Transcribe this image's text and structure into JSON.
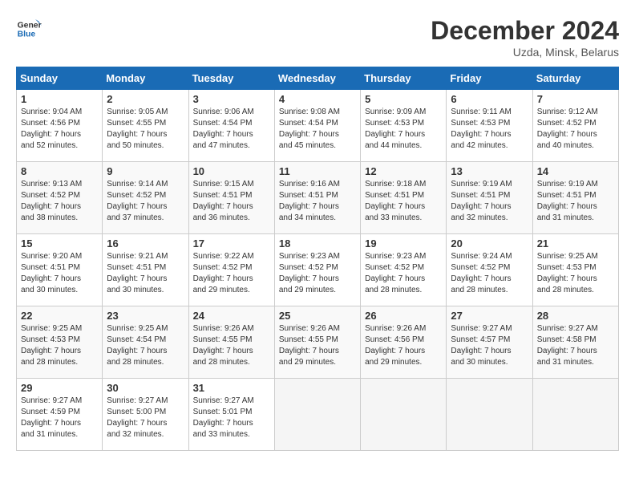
{
  "header": {
    "logo_line1": "General",
    "logo_line2": "Blue",
    "month": "December 2024",
    "location": "Uzda, Minsk, Belarus"
  },
  "days_of_week": [
    "Sunday",
    "Monday",
    "Tuesday",
    "Wednesday",
    "Thursday",
    "Friday",
    "Saturday"
  ],
  "weeks": [
    [
      {
        "num": "1",
        "sunrise": "9:04 AM",
        "sunset": "4:56 PM",
        "daylight": "7 hours and 52 minutes."
      },
      {
        "num": "2",
        "sunrise": "9:05 AM",
        "sunset": "4:55 PM",
        "daylight": "7 hours and 50 minutes."
      },
      {
        "num": "3",
        "sunrise": "9:06 AM",
        "sunset": "4:54 PM",
        "daylight": "7 hours and 47 minutes."
      },
      {
        "num": "4",
        "sunrise": "9:08 AM",
        "sunset": "4:54 PM",
        "daylight": "7 hours and 45 minutes."
      },
      {
        "num": "5",
        "sunrise": "9:09 AM",
        "sunset": "4:53 PM",
        "daylight": "7 hours and 44 minutes."
      },
      {
        "num": "6",
        "sunrise": "9:11 AM",
        "sunset": "4:53 PM",
        "daylight": "7 hours and 42 minutes."
      },
      {
        "num": "7",
        "sunrise": "9:12 AM",
        "sunset": "4:52 PM",
        "daylight": "7 hours and 40 minutes."
      }
    ],
    [
      {
        "num": "8",
        "sunrise": "9:13 AM",
        "sunset": "4:52 PM",
        "daylight": "7 hours and 38 minutes."
      },
      {
        "num": "9",
        "sunrise": "9:14 AM",
        "sunset": "4:52 PM",
        "daylight": "7 hours and 37 minutes."
      },
      {
        "num": "10",
        "sunrise": "9:15 AM",
        "sunset": "4:51 PM",
        "daylight": "7 hours and 36 minutes."
      },
      {
        "num": "11",
        "sunrise": "9:16 AM",
        "sunset": "4:51 PM",
        "daylight": "7 hours and 34 minutes."
      },
      {
        "num": "12",
        "sunrise": "9:18 AM",
        "sunset": "4:51 PM",
        "daylight": "7 hours and 33 minutes."
      },
      {
        "num": "13",
        "sunrise": "9:19 AM",
        "sunset": "4:51 PM",
        "daylight": "7 hours and 32 minutes."
      },
      {
        "num": "14",
        "sunrise": "9:19 AM",
        "sunset": "4:51 PM",
        "daylight": "7 hours and 31 minutes."
      }
    ],
    [
      {
        "num": "15",
        "sunrise": "9:20 AM",
        "sunset": "4:51 PM",
        "daylight": "7 hours and 30 minutes."
      },
      {
        "num": "16",
        "sunrise": "9:21 AM",
        "sunset": "4:51 PM",
        "daylight": "7 hours and 30 minutes."
      },
      {
        "num": "17",
        "sunrise": "9:22 AM",
        "sunset": "4:52 PM",
        "daylight": "7 hours and 29 minutes."
      },
      {
        "num": "18",
        "sunrise": "9:23 AM",
        "sunset": "4:52 PM",
        "daylight": "7 hours and 29 minutes."
      },
      {
        "num": "19",
        "sunrise": "9:23 AM",
        "sunset": "4:52 PM",
        "daylight": "7 hours and 28 minutes."
      },
      {
        "num": "20",
        "sunrise": "9:24 AM",
        "sunset": "4:52 PM",
        "daylight": "7 hours and 28 minutes."
      },
      {
        "num": "21",
        "sunrise": "9:25 AM",
        "sunset": "4:53 PM",
        "daylight": "7 hours and 28 minutes."
      }
    ],
    [
      {
        "num": "22",
        "sunrise": "9:25 AM",
        "sunset": "4:53 PM",
        "daylight": "7 hours and 28 minutes."
      },
      {
        "num": "23",
        "sunrise": "9:25 AM",
        "sunset": "4:54 PM",
        "daylight": "7 hours and 28 minutes."
      },
      {
        "num": "24",
        "sunrise": "9:26 AM",
        "sunset": "4:55 PM",
        "daylight": "7 hours and 28 minutes."
      },
      {
        "num": "25",
        "sunrise": "9:26 AM",
        "sunset": "4:55 PM",
        "daylight": "7 hours and 29 minutes."
      },
      {
        "num": "26",
        "sunrise": "9:26 AM",
        "sunset": "4:56 PM",
        "daylight": "7 hours and 29 minutes."
      },
      {
        "num": "27",
        "sunrise": "9:27 AM",
        "sunset": "4:57 PM",
        "daylight": "7 hours and 30 minutes."
      },
      {
        "num": "28",
        "sunrise": "9:27 AM",
        "sunset": "4:58 PM",
        "daylight": "7 hours and 31 minutes."
      }
    ],
    [
      {
        "num": "29",
        "sunrise": "9:27 AM",
        "sunset": "4:59 PM",
        "daylight": "7 hours and 31 minutes."
      },
      {
        "num": "30",
        "sunrise": "9:27 AM",
        "sunset": "5:00 PM",
        "daylight": "7 hours and 32 minutes."
      },
      {
        "num": "31",
        "sunrise": "9:27 AM",
        "sunset": "5:01 PM",
        "daylight": "7 hours and 33 minutes."
      },
      null,
      null,
      null,
      null
    ]
  ]
}
